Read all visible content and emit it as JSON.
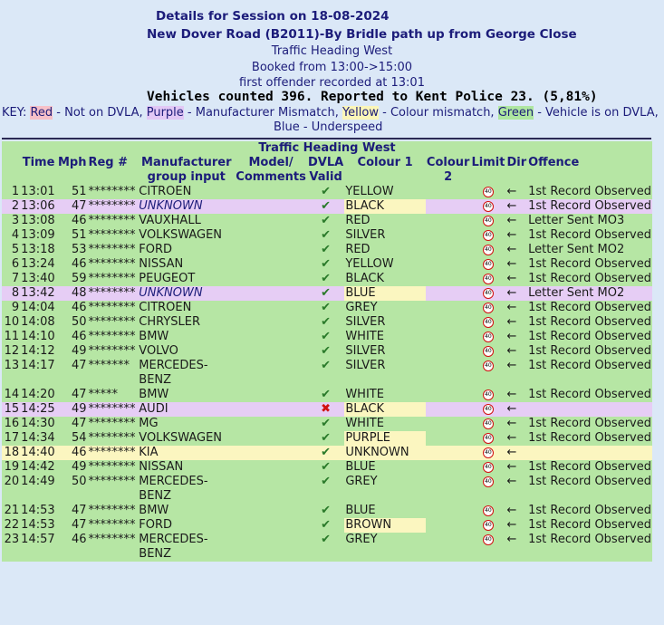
{
  "header": {
    "title": "Details for Session on 18-08-2024",
    "location": "New Dover Road (B2011)-By Bridle path  up from George Close",
    "direction": "Traffic Heading West",
    "booked": "Booked from 13:00->15:00",
    "first_offender": "first offender recorded at 13:01",
    "summary": "Vehicles counted 396.  Reported to Kent Police 23. (5,81%)"
  },
  "key": {
    "prefix": "KEY: ",
    "red": "Red",
    "red_desc": " - Not on DVLA, ",
    "purple": "Purple",
    "purple_desc": " - Manufacturer Mismatch, ",
    "yellow": "Yellow",
    "yellow_desc": " - Colour mismatch, ",
    "green": "Green",
    "green_desc": " - Vehicle is on DVLA,",
    "blue": "Blue",
    "blue_desc": " - Underspeed"
  },
  "table": {
    "title": "Traffic Heading West",
    "headers": {
      "time": "Time",
      "mph": "Mph",
      "reg": "Reg #",
      "manufacturer": "Manufacturer group input",
      "model": "Model/ Comments",
      "dvla": "DVLA Valid",
      "colour1": "Colour 1",
      "colour2": "Colour 2",
      "limit": "Limit",
      "dir": "Dir",
      "offence": "Offence"
    },
    "limit_sign": "40",
    "rows": [
      {
        "n": "1",
        "time": "13:01",
        "mph": "51",
        "reg": "********",
        "manufacturer": "CITROEN",
        "valid": "tick",
        "colour1": "YELLOW",
        "dir": "←",
        "offence": "1st Record Observed",
        "hl": ""
      },
      {
        "n": "2",
        "time": "13:06",
        "mph": "47",
        "reg": "********",
        "manufacturer": "UNKNOWN",
        "valid": "tick",
        "colour1": "BLACK",
        "dir": "←",
        "offence": "1st Record Observed",
        "hl": "purple"
      },
      {
        "n": "3",
        "time": "13:08",
        "mph": "46",
        "reg": "********",
        "manufacturer": "VAUXHALL",
        "valid": "tick",
        "colour1": "RED",
        "dir": "←",
        "offence": "Letter Sent MO3",
        "hl": ""
      },
      {
        "n": "4",
        "time": "13:09",
        "mph": "51",
        "reg": "********",
        "manufacturer": "VOLKSWAGEN",
        "valid": "tick",
        "colour1": "SILVER",
        "dir": "←",
        "offence": "1st Record Observed",
        "hl": ""
      },
      {
        "n": "5",
        "time": "13:18",
        "mph": "53",
        "reg": "********",
        "manufacturer": "FORD",
        "valid": "tick",
        "colour1": "RED",
        "dir": "←",
        "offence": "Letter Sent MO2",
        "hl": ""
      },
      {
        "n": "6",
        "time": "13:24",
        "mph": "46",
        "reg": "********",
        "manufacturer": "NISSAN",
        "valid": "tick",
        "colour1": "YELLOW",
        "dir": "←",
        "offence": "1st Record Observed",
        "hl": ""
      },
      {
        "n": "7",
        "time": "13:40",
        "mph": "59",
        "reg": "********",
        "manufacturer": "PEUGEOT",
        "valid": "tick",
        "colour1": "BLACK",
        "dir": "←",
        "offence": "1st Record Observed",
        "hl": ""
      },
      {
        "n": "8",
        "time": "13:42",
        "mph": "48",
        "reg": "********",
        "manufacturer": "UNKNOWN",
        "valid": "tick",
        "colour1": "BLUE",
        "dir": "←",
        "offence": "Letter Sent MO2",
        "hl": "purple"
      },
      {
        "n": "9",
        "time": "14:04",
        "mph": "46",
        "reg": "********",
        "manufacturer": "CITROEN",
        "valid": "tick",
        "colour1": "GREY",
        "dir": "←",
        "offence": "1st Record Observed",
        "hl": ""
      },
      {
        "n": "10",
        "time": "14:08",
        "mph": "50",
        "reg": "********",
        "manufacturer": "CHRYSLER",
        "valid": "tick",
        "colour1": "SILVER",
        "dir": "←",
        "offence": "1st Record Observed",
        "hl": ""
      },
      {
        "n": "11",
        "time": "14:10",
        "mph": "46",
        "reg": "********",
        "manufacturer": "BMW",
        "valid": "tick",
        "colour1": "WHITE",
        "dir": "←",
        "offence": "1st Record Observed",
        "hl": ""
      },
      {
        "n": "12",
        "time": "14:12",
        "mph": "49",
        "reg": "********",
        "manufacturer": "VOLVO",
        "valid": "tick",
        "colour1": "SILVER",
        "dir": "←",
        "offence": "1st Record Observed",
        "hl": ""
      },
      {
        "n": "13",
        "time": "14:17",
        "mph": "47",
        "reg": "*******",
        "manufacturer": "MERCEDES-BENZ",
        "valid": "tick",
        "colour1": "SILVER",
        "dir": "←",
        "offence": "1st Record Observed",
        "hl": ""
      },
      {
        "n": "14",
        "time": "14:20",
        "mph": "47",
        "reg": "*****",
        "manufacturer": "BMW",
        "valid": "tick",
        "colour1": "WHITE",
        "dir": "←",
        "offence": "1st Record Observed",
        "hl": ""
      },
      {
        "n": "15",
        "time": "14:25",
        "mph": "49",
        "reg": "********",
        "manufacturer": "AUDI",
        "valid": "cross",
        "colour1": "BLACK",
        "dir": "←",
        "offence": "",
        "hl": "purple"
      },
      {
        "n": "16",
        "time": "14:30",
        "mph": "47",
        "reg": "********",
        "manufacturer": "MG",
        "valid": "tick",
        "colour1": "WHITE",
        "dir": "←",
        "offence": "1st Record Observed",
        "hl": ""
      },
      {
        "n": "17",
        "time": "14:34",
        "mph": "54",
        "reg": "********",
        "manufacturer": "VOLKSWAGEN",
        "valid": "tick",
        "colour1": "PURPLE",
        "dir": "←",
        "offence": "1st Record Observed",
        "hl": "c1"
      },
      {
        "n": "18",
        "time": "14:40",
        "mph": "46",
        "reg": "********",
        "manufacturer": "KIA",
        "valid": "tick",
        "colour1": "UNKNOWN",
        "dir": "←",
        "offence": "",
        "hl": "yellow"
      },
      {
        "n": "19",
        "time": "14:42",
        "mph": "49",
        "reg": "********",
        "manufacturer": "NISSAN",
        "valid": "tick",
        "colour1": "BLUE",
        "dir": "←",
        "offence": "1st Record Observed",
        "hl": ""
      },
      {
        "n": "20",
        "time": "14:49",
        "mph": "50",
        "reg": "********",
        "manufacturer": "MERCEDES-BENZ",
        "valid": "tick",
        "colour1": "GREY",
        "dir": "←",
        "offence": "1st Record Observed",
        "hl": ""
      },
      {
        "n": "21",
        "time": "14:53",
        "mph": "47",
        "reg": "********",
        "manufacturer": "BMW",
        "valid": "tick",
        "colour1": "BLUE",
        "dir": "←",
        "offence": "1st Record Observed",
        "hl": ""
      },
      {
        "n": "22",
        "time": "14:53",
        "mph": "47",
        "reg": "********",
        "manufacturer": "FORD",
        "valid": "tick",
        "colour1": "BROWN",
        "dir": "←",
        "offence": "1st Record Observed",
        "hl": "c1"
      },
      {
        "n": "23",
        "time": "14:57",
        "mph": "46",
        "reg": "********",
        "manufacturer": "MERCEDES-BENZ",
        "valid": "tick",
        "colour1": "GREY",
        "dir": "←",
        "offence": "1st Record Observed",
        "hl": ""
      }
    ]
  },
  "colors": {
    "background": "#dbe8f7",
    "table_green": "#b6e6a4",
    "purple_row": "#e6cdf5",
    "yellow_highlight": "#fbf6c0",
    "heading_text": "#1c1c7a"
  }
}
